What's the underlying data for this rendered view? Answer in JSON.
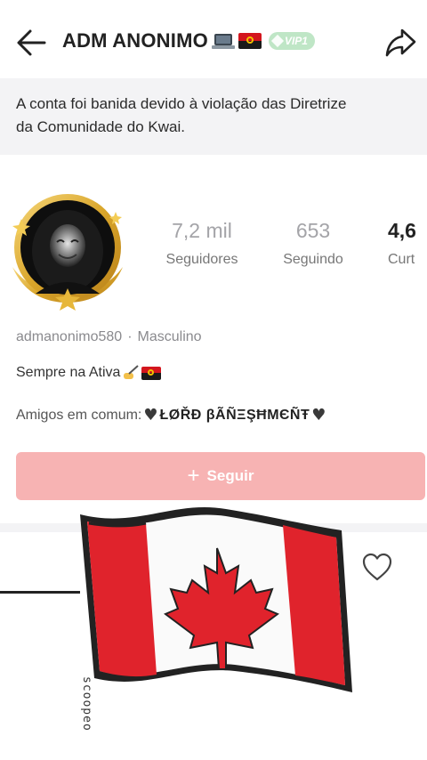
{
  "header": {
    "title": "ADM ANONIMO",
    "title_emojis": [
      "laptop-icon",
      "angola-flag-icon"
    ],
    "vip_label": "VIP1",
    "icons": {
      "back": "arrow-left-icon",
      "share": "share-icon"
    }
  },
  "ban_notice": {
    "line1": "A conta foi banida devido à violação das Diretrize",
    "line2": "da Comunidade do Kwai."
  },
  "profile": {
    "stats": [
      {
        "value": "7,2 mil",
        "label": "Seguidores"
      },
      {
        "value": "653",
        "label": "Seguindo"
      },
      {
        "value": "4,6",
        "label": "Curt"
      }
    ],
    "username": "admanonimo580",
    "separator": "·",
    "gender": "Masculino",
    "bio": "Sempre na Ativa",
    "mutual_prefix": "Amigos em comum:",
    "mutual_name": "ŁØŘĐ βÃÑΞŞĦMЄÑŦ"
  },
  "follow_button": {
    "label": "Seguir",
    "icon": "plus-icon"
  },
  "tabs": {
    "like_icon": "heart-outline-icon"
  },
  "overlay": {
    "sticker": "canada-flag-sticker",
    "vertical_text": "scoopeo"
  },
  "colors": {
    "follow_bg": "#f7b3b3",
    "ban_bg": "#f3f3f5",
    "vip_bg": "#bfe6c6",
    "canada_red": "#e0232c"
  }
}
